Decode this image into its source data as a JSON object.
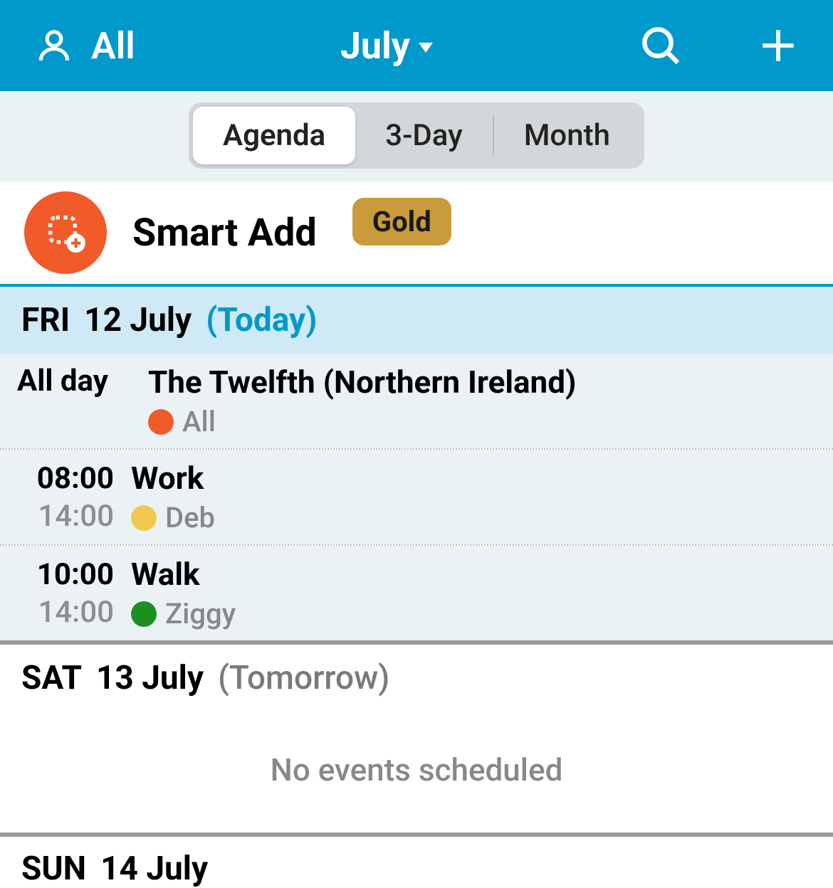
{
  "header": {
    "filter_label": "All",
    "month_label": "July"
  },
  "tabs": [
    {
      "label": "Agenda",
      "active": true
    },
    {
      "label": "3-Day",
      "active": false
    },
    {
      "label": "Month",
      "active": false
    }
  ],
  "smart_add": {
    "label": "Smart Add",
    "badge": "Gold"
  },
  "days": [
    {
      "dow": "FRI",
      "date": "12 July",
      "suffix": "(Today)",
      "is_today": true,
      "events": [
        {
          "all_day": true,
          "all_day_label": "All day",
          "title": "The Twelfth (Northern Ireland)",
          "calendar": {
            "name": "All",
            "color": "#F15A29"
          }
        },
        {
          "all_day": false,
          "start": "08:00",
          "end": "14:00",
          "title": "Work",
          "calendar": {
            "name": "Deb",
            "color": "#F2C94C"
          }
        },
        {
          "all_day": false,
          "start": "10:00",
          "end": "14:00",
          "title": "Walk",
          "calendar": {
            "name": "Ziggy",
            "color": "#1E8E1E"
          }
        }
      ]
    },
    {
      "dow": "SAT",
      "date": "13 July",
      "suffix": "(Tomorrow)",
      "is_today": false,
      "no_events_label": "No events scheduled"
    },
    {
      "dow": "SUN",
      "date": "14 July"
    }
  ]
}
